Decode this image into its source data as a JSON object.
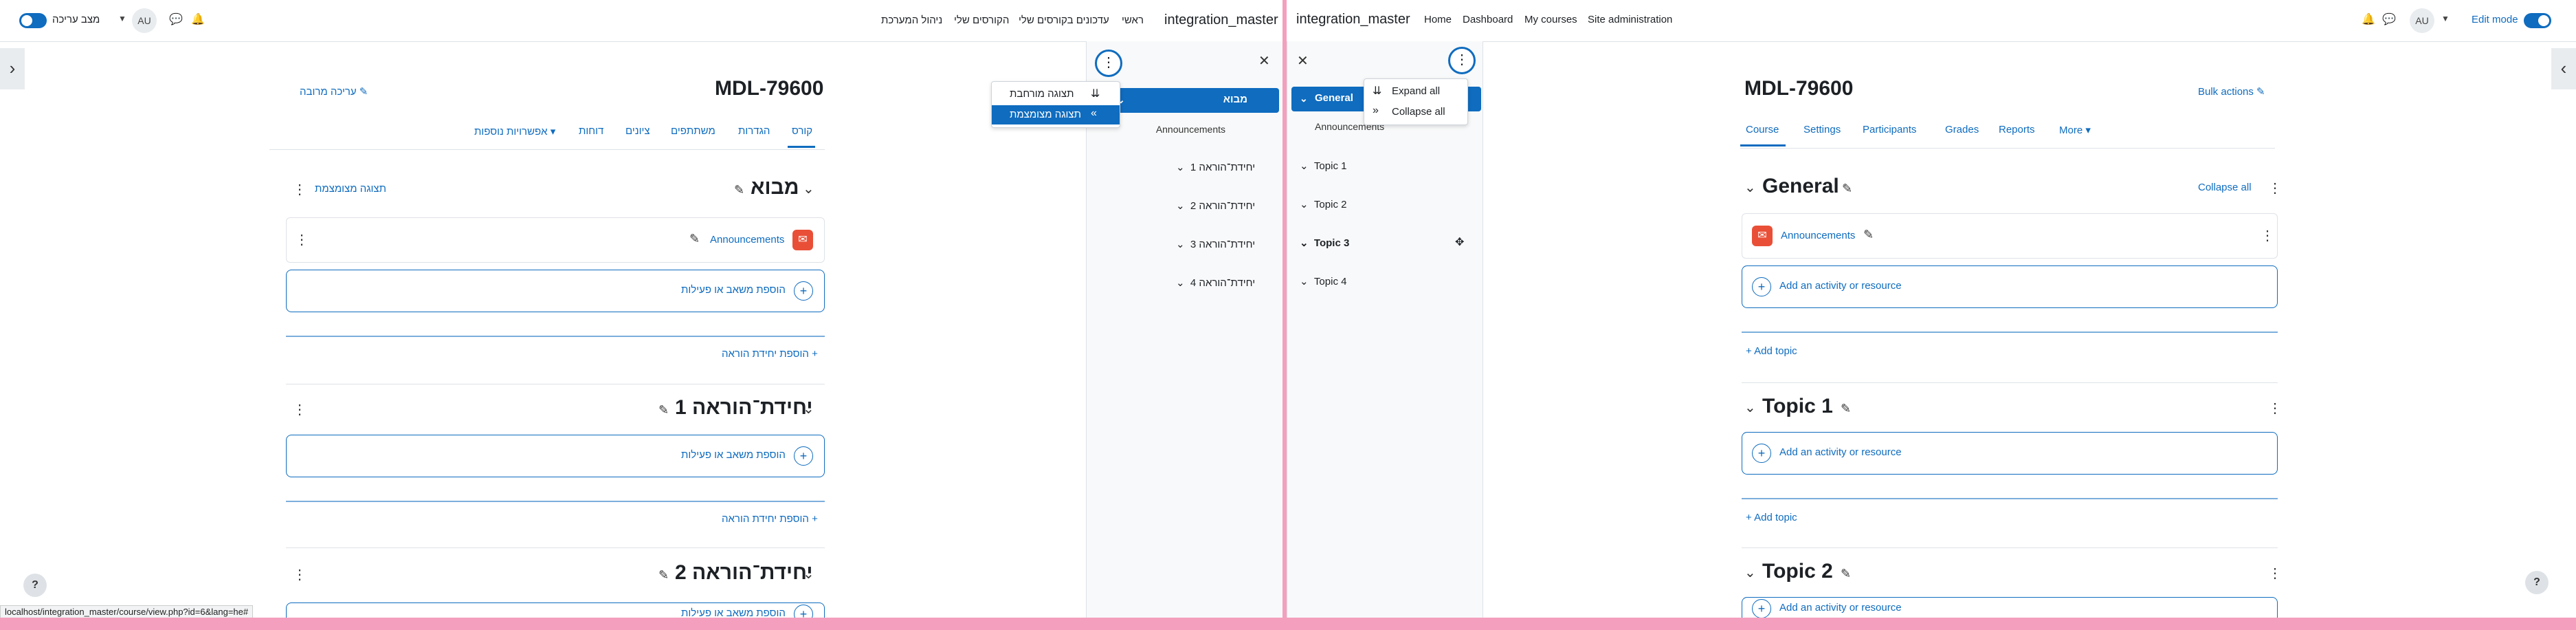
{
  "he": {
    "nav": {
      "site_name": "integration_master",
      "items": [
        "ראשי",
        "עדכונים בקורסים שלי",
        "הקורסים שלי",
        "ניהול המערכת"
      ],
      "avatar": "AU",
      "edit_mode_label": "מצב עריכה"
    },
    "course_title": "MDL-79600",
    "bulk_edit": "עריכה מרובה",
    "tabs": [
      "קורס",
      "הגדרות",
      "משתתפים",
      "ציונים",
      "דוחות",
      "אפשרויות נוספות"
    ],
    "collapsed_view_link": "תצוגה מצומצמת",
    "sections": [
      {
        "title": "מבוא"
      },
      {
        "title": "יחידת־הוראה 1"
      },
      {
        "title": "יחידת־הוראה 2"
      }
    ],
    "announcements": "Announcements",
    "add_activity": "הוספת משאב או פעילות",
    "add_section": "הוספת יחידת הוראה",
    "index": {
      "active": "מבוא",
      "sub": "Announcements",
      "items": [
        "יחידת־הוראה 1",
        "יחידת־הוראה 2",
        "יחידת־הוראה 3",
        "יחידת־הוראה 4"
      ]
    },
    "menu": {
      "expanded": "תצוגה מורחבת",
      "collapsed": "תצוגה מצומצמת"
    },
    "status_url": "localhost/integration_master/course/view.php?id=6&lang=he#",
    "help": "?"
  },
  "en": {
    "nav": {
      "site_name": "integration_master",
      "items": [
        "Home",
        "Dashboard",
        "My courses",
        "Site administration"
      ],
      "avatar": "AU",
      "edit_mode_label": "Edit mode"
    },
    "course_title": "MDL-79600",
    "bulk_actions": "Bulk actions",
    "tabs": [
      "Course",
      "Settings",
      "Participants",
      "Grades",
      "Reports",
      "More"
    ],
    "collapse_all": "Collapse all",
    "sections": [
      {
        "title": "General"
      },
      {
        "title": "Topic 1"
      },
      {
        "title": "Topic 2"
      }
    ],
    "announcements": "Announcements",
    "add_activity": "Add an activity or resource",
    "add_topic": "Add topic",
    "index": {
      "active": "General",
      "sub": "Announcements",
      "items": [
        "Topic 1",
        "Topic 2",
        "Topic 3",
        "Topic 4"
      ]
    },
    "menu": {
      "expand_all": "Expand all",
      "collapse_all": "Collapse all"
    },
    "help": "?"
  },
  "colors": {
    "brand": "#0f6cbf",
    "separator": "#f49fbd",
    "announcement_icon": "#e94f37"
  },
  "icons": [
    "bell-icon",
    "chat-icon",
    "chevron-down-icon",
    "close-icon",
    "kebab-icon",
    "pencil-icon",
    "plus-icon",
    "expand-all-icon",
    "collapse-all-icon",
    "drag-move-icon",
    "help-icon"
  ]
}
